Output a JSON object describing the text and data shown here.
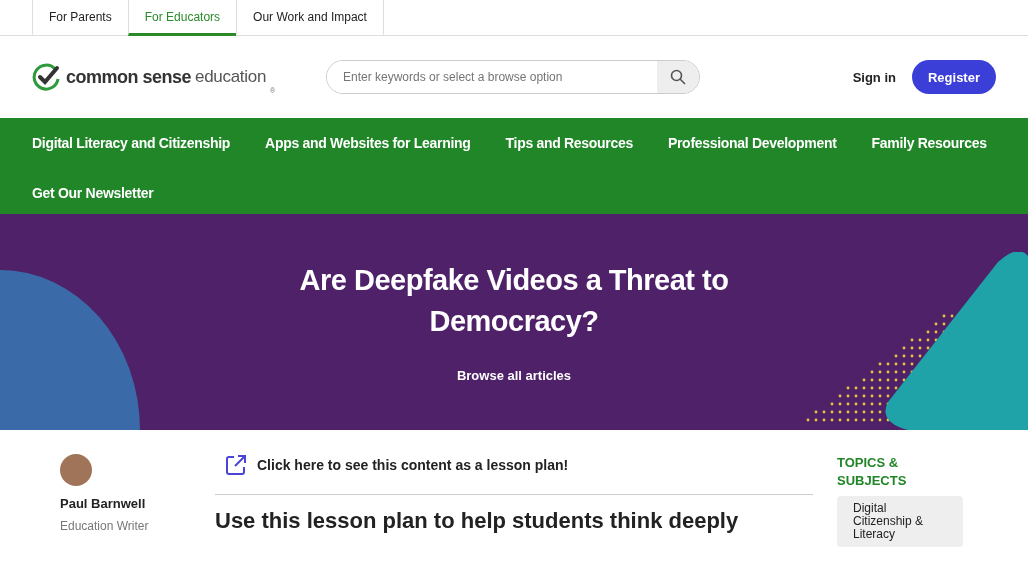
{
  "top_tabs": [
    {
      "label": "For Parents",
      "selected": false
    },
    {
      "label": "For Educators",
      "selected": true
    },
    {
      "label": "Our Work and Impact",
      "selected": false
    }
  ],
  "logo": {
    "bold": "common sense",
    "light": "education",
    "mark": "®"
  },
  "search": {
    "placeholder": "Enter keywords or select a browse option"
  },
  "account": {
    "sign_in": "Sign in",
    "register": "Register"
  },
  "nav": [
    "Digital Literacy and Citizenship",
    "Apps and Websites for Learning",
    "Tips and Resources",
    "Professional Development",
    "Family Resources",
    "Get Our Newsletter"
  ],
  "hero": {
    "title": "Are Deepfake Videos a Threat to Democracy?",
    "link": "Browse all articles"
  },
  "author": {
    "name": "Paul Barnwell",
    "role": "Education Writer"
  },
  "lesson_link": "Click here to see this content as a lesson plan!",
  "heading": "Use this lesson plan to help students think deeply",
  "topics": {
    "title": "TOPICS & SUBJECTS",
    "tags": [
      "Digital Citizenship & Literacy"
    ]
  }
}
